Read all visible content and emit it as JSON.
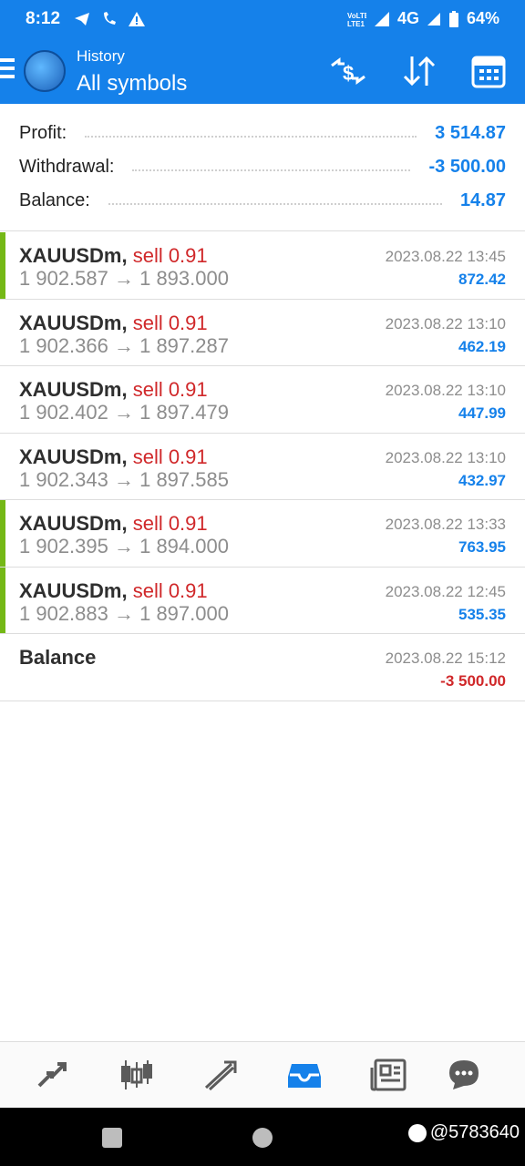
{
  "status_bar": {
    "time": "8:12",
    "network": "4G",
    "battery": "64%"
  },
  "header": {
    "subtitle": "History",
    "title": "All symbols"
  },
  "summary": {
    "profit_label": "Profit:",
    "profit_value": "3 514.87",
    "withdrawal_label": "Withdrawal:",
    "withdrawal_value": "-3 500.00",
    "balance_label": "Balance:",
    "balance_value": "14.87"
  },
  "deals": [
    {
      "symbol": "XAUUSDm,",
      "side": "sell 0.91",
      "prices": "1 902.587 → 1 893.000",
      "datetime": "2023.08.22 13:45",
      "profit": "872.42",
      "highlight": true
    },
    {
      "symbol": "XAUUSDm,",
      "side": "sell 0.91",
      "prices": "1 902.366 → 1 897.287",
      "datetime": "2023.08.22 13:10",
      "profit": "462.19",
      "highlight": false
    },
    {
      "symbol": "XAUUSDm,",
      "side": "sell 0.91",
      "prices": "1 902.402 → 1 897.479",
      "datetime": "2023.08.22 13:10",
      "profit": "447.99",
      "highlight": false
    },
    {
      "symbol": "XAUUSDm,",
      "side": "sell 0.91",
      "prices": "1 902.343 → 1 897.585",
      "datetime": "2023.08.22 13:10",
      "profit": "432.97",
      "highlight": false
    },
    {
      "symbol": "XAUUSDm,",
      "side": "sell 0.91",
      "prices": "1 902.395 → 1 894.000",
      "datetime": "2023.08.22 13:33",
      "profit": "763.95",
      "highlight": true
    },
    {
      "symbol": "XAUUSDm,",
      "side": "sell 0.91",
      "prices": "1 902.883 → 1 897.000",
      "datetime": "2023.08.22 12:45",
      "profit": "535.35",
      "highlight": true
    }
  ],
  "balance_entry": {
    "label": "Balance",
    "datetime": "2023.08.22 15:12",
    "amount": "-3 500.00"
  },
  "bottom_nav": [
    "quotes-icon",
    "chart-icon",
    "trade-icon",
    "history-icon",
    "news-icon",
    "chat-icon"
  ],
  "watermark": "@5783640",
  "colors": {
    "brand_blue": "#1581ea",
    "sell_red": "#d0282a",
    "win_green": "#74b816"
  }
}
